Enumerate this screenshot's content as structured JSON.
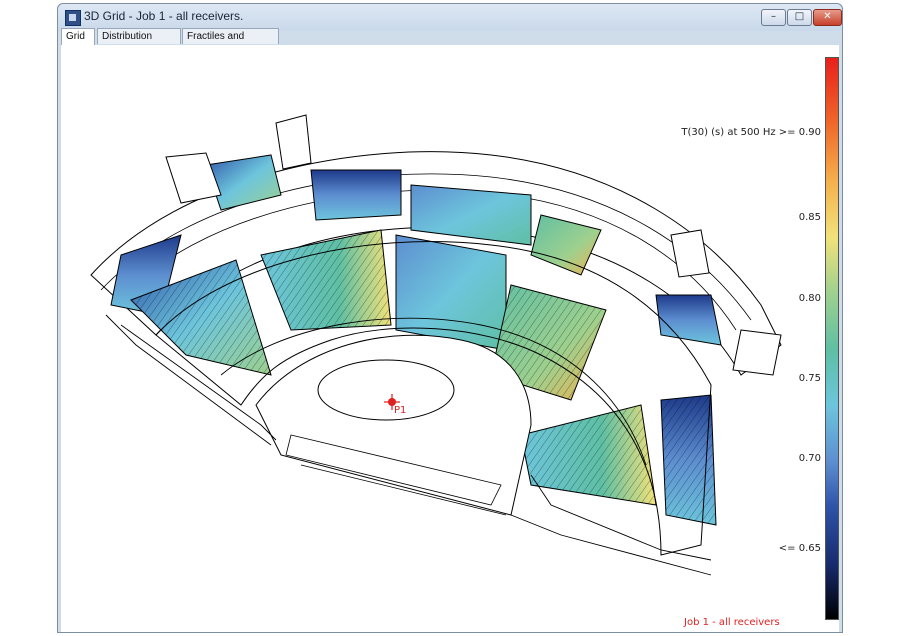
{
  "window": {
    "title": "3D Grid - Job 1 - all receivers.",
    "buttons": {
      "minimize": "–",
      "maximize": "□",
      "close": "✕"
    }
  },
  "tabs": [
    {
      "label": "Grid",
      "active": true
    },
    {
      "label": "Distribution graph",
      "active": false
    },
    {
      "label": "Fractiles and average",
      "active": false
    }
  ],
  "plot": {
    "metric_label": "T(30) (s)  at 500 Hz >= 0.90",
    "scale_labels": [
      "0.85",
      "0.80",
      "0.75",
      "0.70",
      "<= 0.65"
    ],
    "source_label": "P1",
    "footer": "Job 1 - all receivers",
    "colormap": [
      "#e8201b",
      "#f5b04c",
      "#f2e27a",
      "#9ed08e",
      "#6dc5dc",
      "#5d8ed0",
      "#2e53a8",
      "#182c70",
      "#000000"
    ]
  }
}
